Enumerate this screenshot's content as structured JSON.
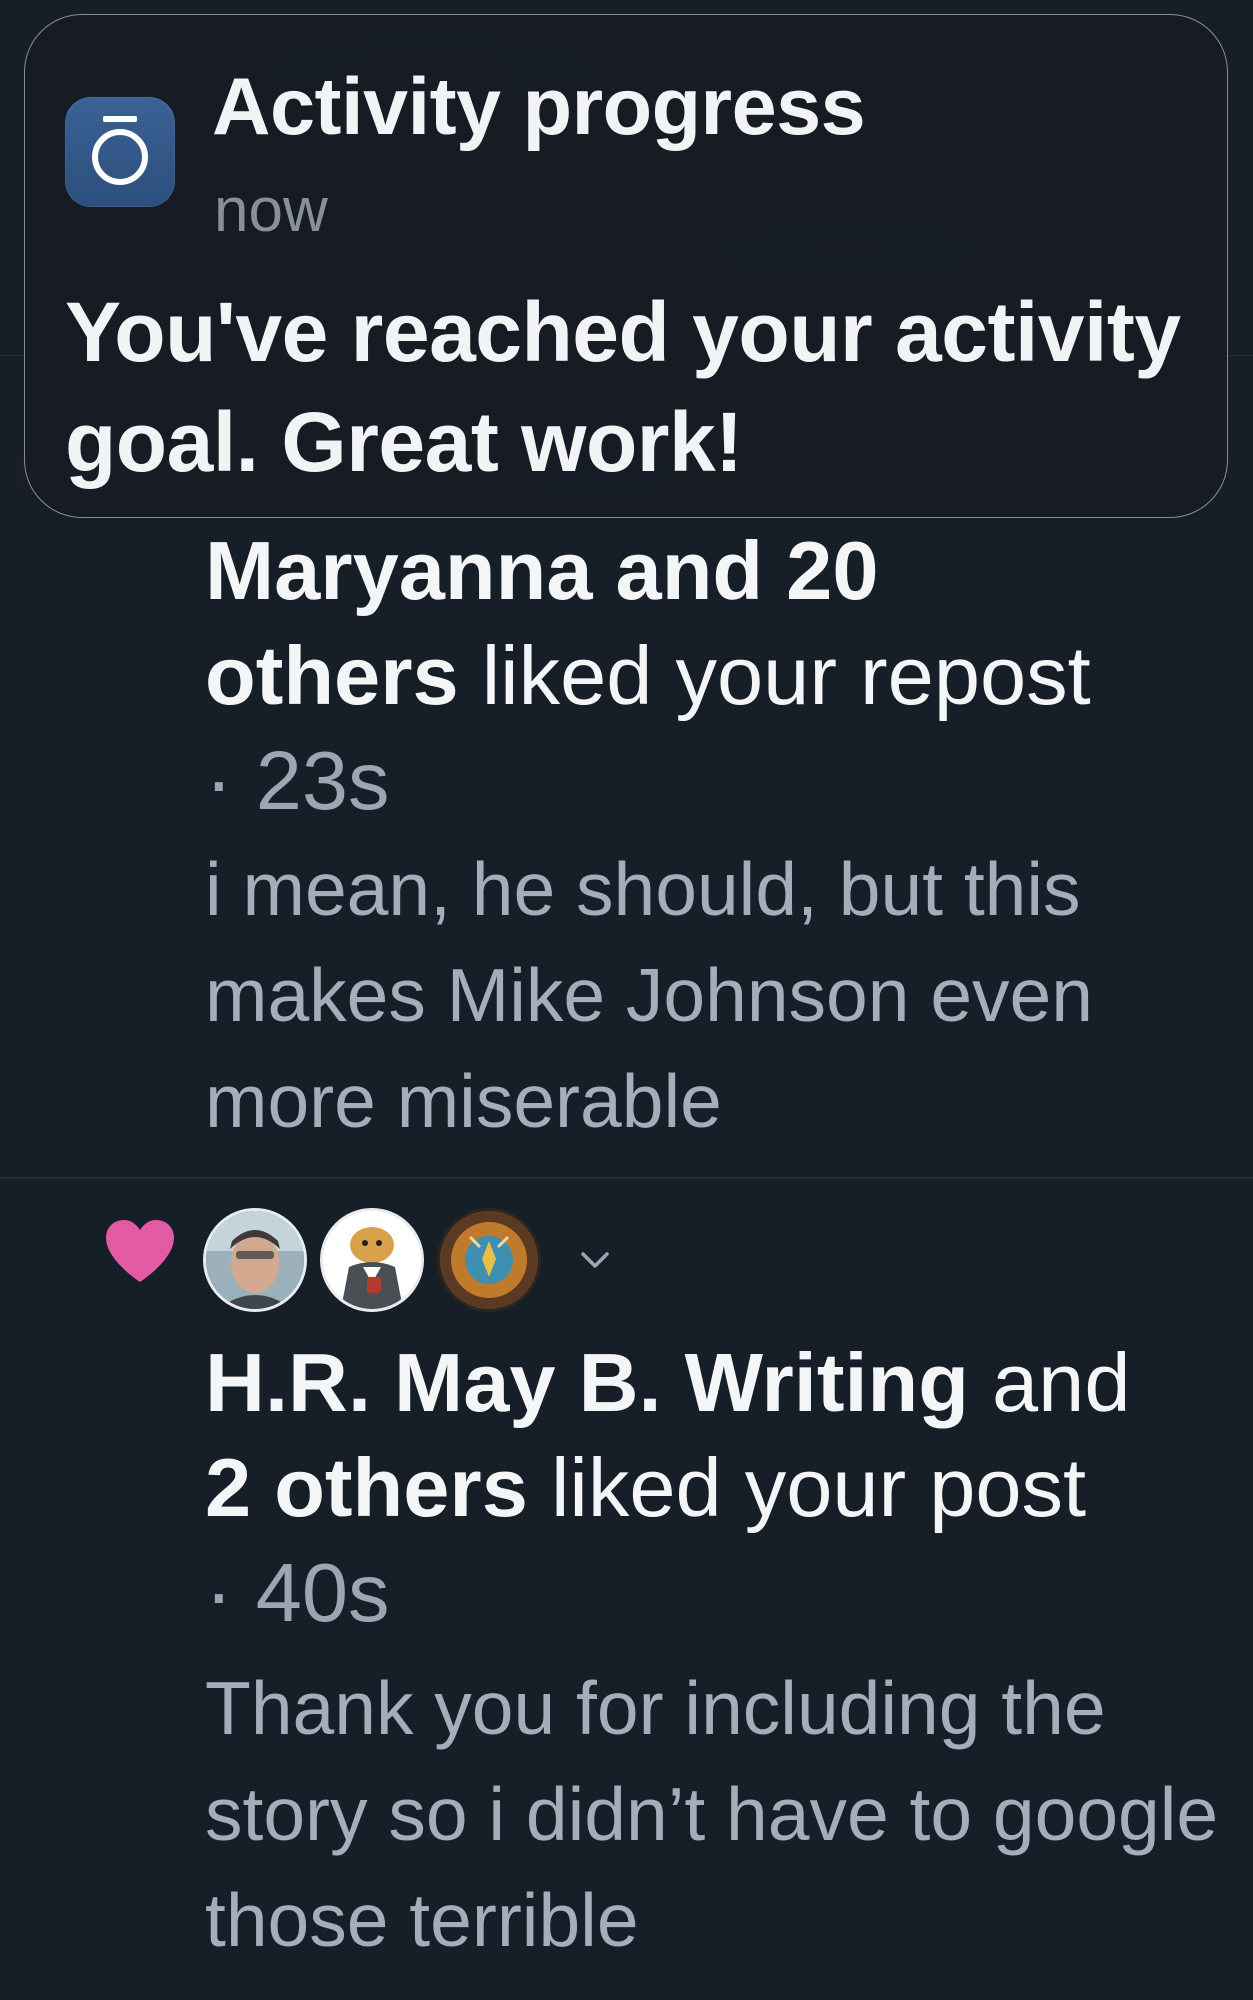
{
  "banner": {
    "app_icon": "activity-ring-icon",
    "title": "Activity progress",
    "time": "now",
    "message": "You've reached your activity goal. Great work!"
  },
  "feed": [
    {
      "actor": "Maryanna and 20",
      "actor_strong_part2": "others",
      "action": " liked your repost",
      "time": "· 23s",
      "post": "i mean, he should, but this makes Mike Johnson even more miserable"
    },
    {
      "icon": "heart-icon",
      "avatars": [
        "avatar-person",
        "avatar-cartoon",
        "avatar-artwork"
      ],
      "expand_icon": "chevron-down-icon",
      "actor": "H.R. May B. Writing",
      "actor_mid": " and",
      "actor_strong_part2": "2 others",
      "action": " liked your post",
      "time": "· 40s",
      "post": "Thank you for including the story so i didn’t have to google those terrible"
    }
  ],
  "colors": {
    "background": "#161e27",
    "heart": "#e35aa5",
    "app_icon": "#2f5585",
    "muted_text": "#a4adbb"
  }
}
